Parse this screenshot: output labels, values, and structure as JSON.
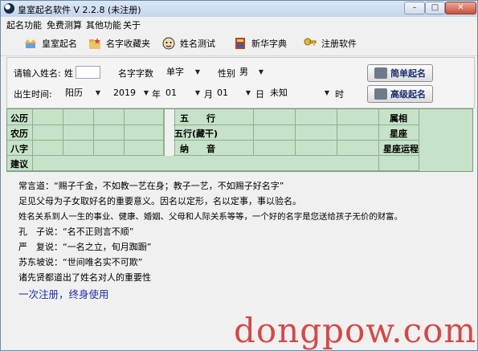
{
  "window": {
    "title": "皇室起名软件 V 2.2.8 (未注册)"
  },
  "menu": [
    "起名功能",
    "免费测算",
    "其他功能",
    "关于"
  ],
  "toolbar": {
    "items": [
      {
        "label": "皇室起名",
        "icon": "crown-icon"
      },
      {
        "label": "名字收藏夹",
        "icon": "folder-star-icon"
      },
      {
        "label": "姓名测试",
        "icon": "face-icon"
      },
      {
        "label": "新华字典",
        "icon": "dictionary-icon"
      },
      {
        "label": "注册软件",
        "icon": "key-icon"
      }
    ]
  },
  "form": {
    "surname_label": "请输入姓名:",
    "surname_prefix": "姓",
    "surname_value": "",
    "name_count_label": "名字字数",
    "name_count_value": "单字",
    "gender_label": "性别",
    "gender_value": "男",
    "birth_label": "出生时间:",
    "calendar_value": "阳历",
    "year_value": "2019",
    "year_unit": "年",
    "month_value": "01",
    "month_unit": "月",
    "day_value": "01",
    "day_unit": "日",
    "hour_value": "未知",
    "hour_unit": "时",
    "simple_btn": "简单起名",
    "advanced_btn": "高级起名"
  },
  "grid": {
    "row_labels": [
      "公历",
      "农历",
      "八字",
      "建议"
    ],
    "mid_labels": [
      "五　　行",
      "五行(藏干)",
      "纳　　音"
    ],
    "right_labels": [
      "属相",
      "星座",
      "星座运程"
    ]
  },
  "text": {
    "lines": [
      "常言道：“赐子千金，不如教一艺在身；教子一艺，不如赐子好名字”",
      "足见父母为子女取好名的重要意义。因名以定形，名以定事，事以验名。",
      "姓名关系到人一生的事业、健康、婚姻、父母和人际关系等等，一个好的名字是您送给孩子无价的财富。",
      "孔　子说：“名不正则言不顺”",
      "严　复说：“一名之立，旬月踟蹰”",
      "苏东坡说：“世间唯名实不可欺”",
      "诸先贤都道出了姓名对人的重要性"
    ],
    "footer": "一次注册，终身使用"
  },
  "watermark": "dongpow.com"
}
